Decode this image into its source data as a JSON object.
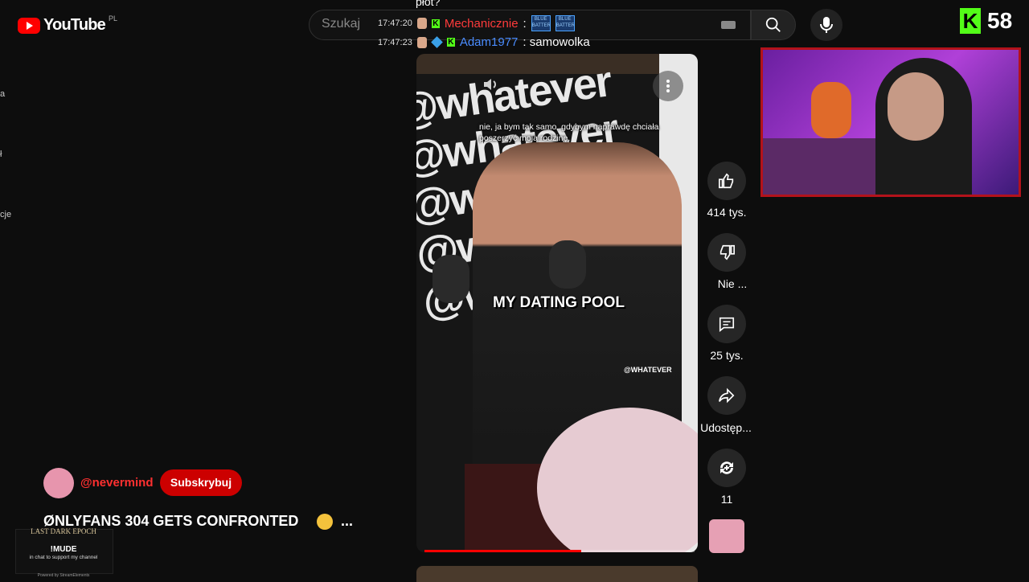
{
  "header": {
    "logo_text": "YouTube",
    "region": "PL",
    "search_placeholder": "Szukaj",
    "kick_count": "58",
    "kick_badge": "K"
  },
  "chat": {
    "previous_text": "płot?",
    "lines": [
      {
        "time": "17:47:20",
        "username": "Mechanicznie",
        "user_color": "#ff3b3b",
        "message": ":",
        "emotes": [
          "BLUE BATTER",
          "BLUE BATTER"
        ]
      },
      {
        "time": "17:47:23",
        "username": "Adam1977",
        "user_color": "#4a8cff",
        "message": ": samowolka"
      }
    ]
  },
  "video": {
    "subtitle": "nie, ja bym tak samo, gdybym naprawdę chciała poszerzyć moją rodzinę,",
    "caption": "MY DATING POOL",
    "watermark": "@WHATEVER",
    "background_text": "@whatever @whatever @whatever @whatever @whatever",
    "progress": 0.58
  },
  "actions": {
    "like_count": "414 tys.",
    "dislike_label": "Nie ...",
    "comments_count": "25 tys.",
    "share_label": "Udostęp...",
    "remix_count": "11"
  },
  "channel": {
    "name": "@nevermind",
    "subscribe_label": "Subskrybuj",
    "title": "ØNLYFANS 304 GETS CONFRONTED",
    "title_more": "..."
  },
  "sidebar_fragments": [
    "a",
    "ł",
    "cje"
  ],
  "widget": {
    "brand": "LAST DARK EPOCH",
    "command": "!MUDE",
    "text": "in chat to support my channel",
    "powered": "Powered by StreamElements"
  },
  "colors": {
    "accent": "#ff0000",
    "kick_green": "#53fc18",
    "webcam_border": "#b3121b"
  }
}
